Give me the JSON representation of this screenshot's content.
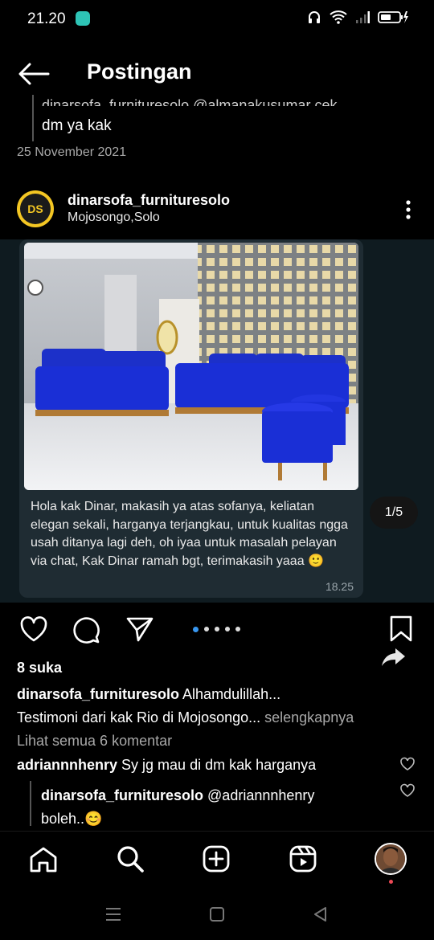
{
  "status": {
    "time": "21.20"
  },
  "header": {
    "title": "Postingan"
  },
  "prev_reply": {
    "cut_text": "dinarsofa_furnituresolo @almanakusumar cek",
    "text": "dm ya kak",
    "date": "25 November 2021"
  },
  "post": {
    "avatar_text": "DS",
    "username": "dinarsofa_furnituresolo",
    "location": "Mojosongo,Solo",
    "counter": "1/5",
    "bubble_caption": "Hola kak Dinar, makasih ya atas sofanya, keliatan elegan sekali, harganya terjangkau, untuk kualitas ngga usah ditanya lagi deh, oh iyaa untuk masalah pelayan via chat, Kak Dinar ramah bgt, terimakasih yaaa 🙂",
    "bubble_time": "18.25"
  },
  "likes": "8 suka",
  "caption": {
    "username": "dinarsofa_furnituresolo",
    "text_line1": " Alhamdulillah...",
    "text_line2": "Testimoni dari kak Rio di Mojosongo...",
    "more": " selengkapnya"
  },
  "view_all": "Lihat semua 6 komentar",
  "comments": [
    {
      "username": "adriannnhenry",
      "text": " Sy jg mau di dm kak harganya"
    },
    {
      "username": "dinarsofa_furnituresolo",
      "text": " @adriannnhenry",
      "text2": "boleh..😊"
    }
  ],
  "colors": {
    "accent": "#3897f0",
    "bubble": "#1f2c33",
    "sofa": "#1a2fd6",
    "notif": "#ed4956"
  }
}
